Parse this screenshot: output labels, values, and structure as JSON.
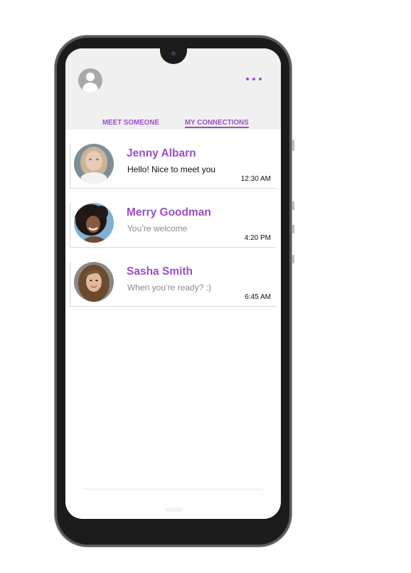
{
  "header": {
    "profile_icon": "user-avatar-icon",
    "menu_icon": "more-horizontal-icon"
  },
  "tabs": [
    {
      "label": "MEET SOMEONE",
      "active": false
    },
    {
      "label": "MY CONNECTIONS",
      "active": true
    }
  ],
  "connections": [
    {
      "name": "Jenny Albarn",
      "message": "Hello! Nice to meet you",
      "time": "12:30 AM",
      "unread": true
    },
    {
      "name": "Merry Goodman",
      "message": "You’re welcome",
      "time": "4:20 PM",
      "unread": false
    },
    {
      "name": "Sasha Smith",
      "message": "When you’re ready? :)",
      "time": "6:45 AM",
      "unread": false
    }
  ],
  "colors": {
    "accent": "#9b4dca",
    "header_bg": "#f0f0f0",
    "frame": "#1b1b1b"
  }
}
